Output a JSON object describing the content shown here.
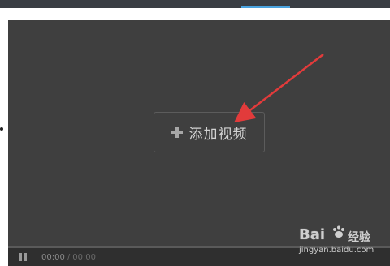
{
  "player": {
    "add_video_label": "添加视频",
    "icon": "plus-icon"
  },
  "controlbar": {
    "pause_icon": "pause-icon",
    "current_time": "00:00",
    "separator": "/",
    "total_time": "00:00"
  },
  "watermark": {
    "brand": "Bai",
    "brand_suffix": "经验",
    "url": "jingyan.baidu.com"
  },
  "colors": {
    "player_bg": "#3f3f3f",
    "arrow": "#e23b3b",
    "topbar_accent": "#4aa3df"
  }
}
